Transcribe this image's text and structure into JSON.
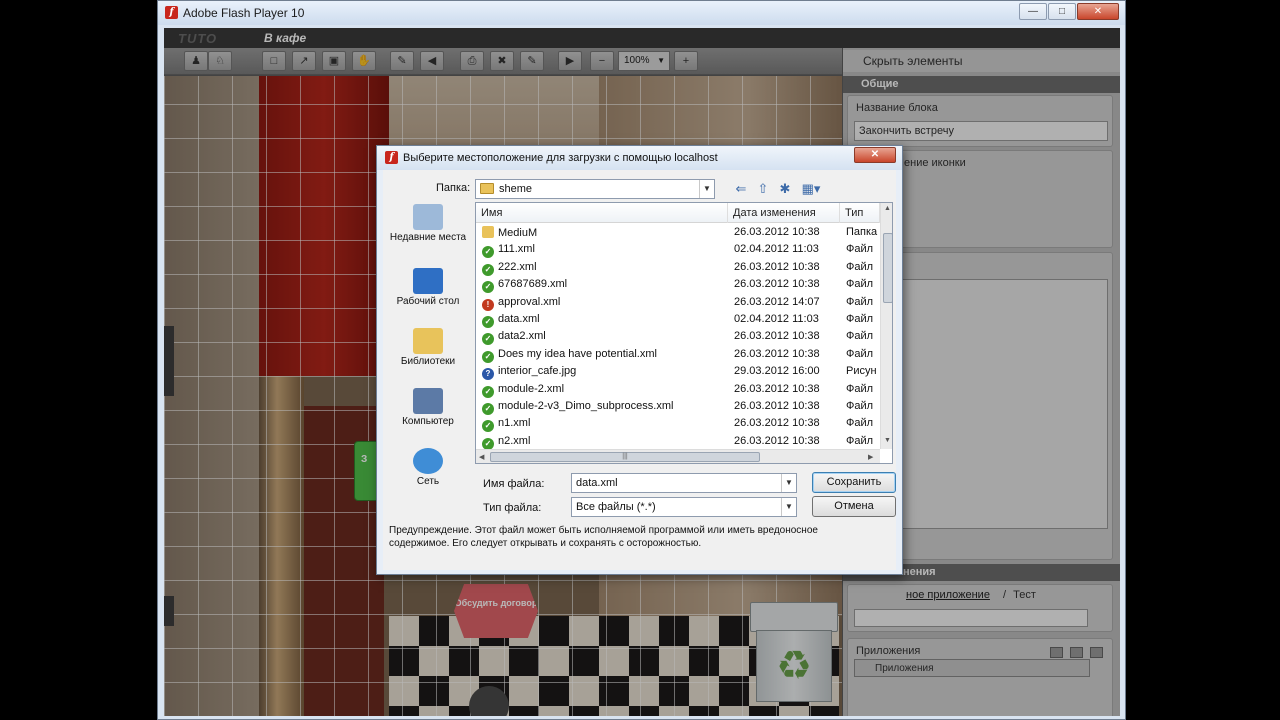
{
  "window": {
    "title": "Adobe Flash Player 10"
  },
  "app": {
    "logo": "TUTO",
    "page_title": "В кафе",
    "zoom": "100%",
    "nodes": {
      "green_label": "З",
      "hex_label": "Обсудить договор"
    }
  },
  "right_panel": {
    "hide_elements": "Скрыть элементы",
    "section_general": "Общие",
    "block_name_label": "Название блока",
    "block_name_value": "Закончить встречу",
    "icon_label_partial": "ение иконки",
    "section_app_partial": "нения",
    "app_link": "ное приложение",
    "app_sep": "/",
    "app_test": "Тест",
    "apps_label": "Приложения",
    "apps_table_header": "Приложения"
  },
  "dialog": {
    "title": "Выберите местоположение для загрузки с помощью localhost",
    "folder_label": "Папка:",
    "folder_value": "sheme",
    "places": [
      {
        "label": "Недавние места",
        "icon": "recent-places-icon",
        "color": "#9db9d9"
      },
      {
        "label": "Рабочий стол",
        "icon": "desktop-icon",
        "color": "#2f6fc4"
      },
      {
        "label": "Библиотеки",
        "icon": "libraries-icon",
        "color": "#e8c35b"
      },
      {
        "label": "Компьютер",
        "icon": "computer-icon",
        "color": "#5c7aa6"
      },
      {
        "label": "Сеть",
        "icon": "network-icon",
        "color": "#3f8dd6"
      }
    ],
    "columns": {
      "name": "Имя",
      "date": "Дата изменения",
      "type": "Тип"
    },
    "files": [
      {
        "name": "MediuM",
        "date": "26.03.2012 10:38",
        "type": "Папка",
        "icon": "folder"
      },
      {
        "name": "111.xml",
        "date": "02.04.2012 11:03",
        "type": "Файл",
        "icon": "green"
      },
      {
        "name": "222.xml",
        "date": "26.03.2012 10:38",
        "type": "Файл",
        "icon": "green"
      },
      {
        "name": "67687689.xml",
        "date": "26.03.2012 10:38",
        "type": "Файл",
        "icon": "green"
      },
      {
        "name": "approval.xml",
        "date": "26.03.2012 14:07",
        "type": "Файл",
        "icon": "red"
      },
      {
        "name": "data.xml",
        "date": "02.04.2012 11:03",
        "type": "Файл",
        "icon": "green"
      },
      {
        "name": "data2.xml",
        "date": "26.03.2012 10:38",
        "type": "Файл",
        "icon": "green"
      },
      {
        "name": "Does my idea have potential.xml",
        "date": "26.03.2012 10:38",
        "type": "Файл",
        "icon": "green"
      },
      {
        "name": "interior_cafe.jpg",
        "date": "29.03.2012 16:00",
        "type": "Рисун",
        "icon": "blue"
      },
      {
        "name": "module-2.xml",
        "date": "26.03.2012 10:38",
        "type": "Файл",
        "icon": "green"
      },
      {
        "name": "module-2-v3_Dimo_subprocess.xml",
        "date": "26.03.2012 10:38",
        "type": "Файл",
        "icon": "green"
      },
      {
        "name": "n1.xml",
        "date": "26.03.2012 10:38",
        "type": "Файл",
        "icon": "green"
      },
      {
        "name": "n2.xml",
        "date": "26.03.2012 10:38",
        "type": "Файл",
        "icon": "green"
      }
    ],
    "filename_label": "Имя файла:",
    "filename_value": "data.xml",
    "filetype_label": "Тип файла:",
    "filetype_value": "Все файлы (*.*)",
    "save_button": "Сохранить",
    "cancel_button": "Отмена",
    "warning": "Предупреждение. Этот файл может быть исполняемой программой или иметь вредоносное содержимое. Его следует открывать и сохранять с осторожностью."
  }
}
